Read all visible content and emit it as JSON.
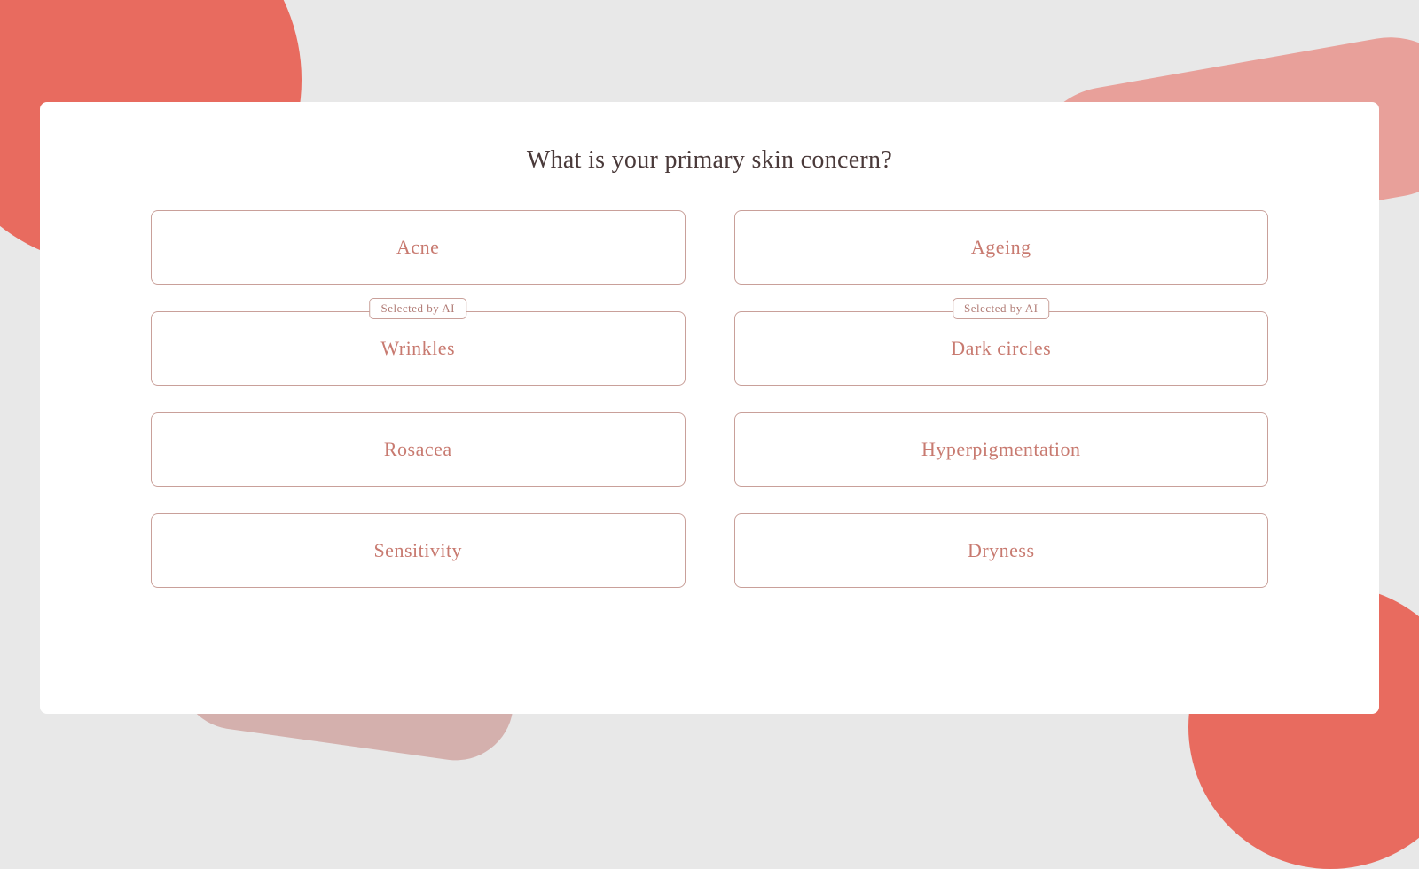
{
  "page": {
    "title": "What is your primary skin concern?",
    "background": {
      "color": "#e8e8e8"
    }
  },
  "options": [
    {
      "id": "acne",
      "label": "Acne",
      "ai_selected": false,
      "ai_label": null
    },
    {
      "id": "ageing",
      "label": "Ageing",
      "ai_selected": false,
      "ai_label": null
    },
    {
      "id": "wrinkles",
      "label": "Wrinkles",
      "ai_selected": true,
      "ai_label": "Selected by AI"
    },
    {
      "id": "dark-circles",
      "label": "Dark circles",
      "ai_selected": true,
      "ai_label": "Selected by AI"
    },
    {
      "id": "rosacea",
      "label": "Rosacea",
      "ai_selected": false,
      "ai_label": null
    },
    {
      "id": "hyperpigmentation",
      "label": "Hyperpigmentation",
      "ai_selected": false,
      "ai_label": null
    },
    {
      "id": "sensitivity",
      "label": "Sensitivity",
      "ai_selected": false,
      "ai_label": null
    },
    {
      "id": "dryness",
      "label": "Dryness",
      "ai_selected": false,
      "ai_label": null
    }
  ]
}
